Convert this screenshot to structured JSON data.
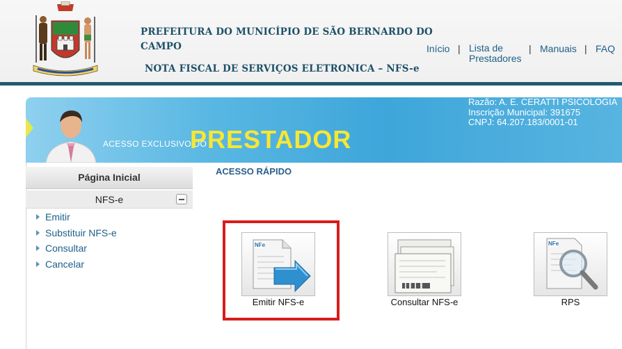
{
  "header": {
    "title_line1": "PREFEITURA DO MUNICÍPIO DE SÃO BERNARDO DO CAMPO",
    "title_line2": "NOTA FISCAL DE SERVIÇOS ELETRONICA – NFS-e",
    "crest_motto": "PELA PATRIA PELA FIDE PRO PATRIA"
  },
  "nav": {
    "inicio": "Início",
    "lista_line1": "Lista de",
    "lista_line2": "Prestadores",
    "manuais": "Manuais",
    "faq": "FAQ",
    "separator": "|"
  },
  "banner": {
    "subtitle": "ACESSO EXCLUSIVO DO",
    "title": "PRESTADOR",
    "razao": "Razão: A. E. CERATTI PSICOLOGIA",
    "inscricao": "Inscrição Municipal: 391675",
    "cnpj": "CNPJ: 64.207.183/0001-01"
  },
  "sidebar": {
    "heading": "Página Inicial",
    "section": "NFS-e",
    "items": [
      {
        "label": "Emitir"
      },
      {
        "label": "Substituir NFS-e"
      },
      {
        "label": "Consultar"
      },
      {
        "label": "Cancelar"
      }
    ]
  },
  "main": {
    "section_title": "ACESSO RÁPIDO",
    "tiles": [
      {
        "label": "Emitir NFS-e",
        "icon": "emit-nfse-icon"
      },
      {
        "label": "Consultar NFS-e",
        "icon": "documents-icon"
      },
      {
        "label": "RPS",
        "icon": "magnifier-icon"
      }
    ],
    "icon_badge": "NFe"
  },
  "colors": {
    "header_title": "#1e5068",
    "link": "#1d5f88",
    "banner_yellow": "#f7e733",
    "highlight_red": "#d91c1c"
  }
}
